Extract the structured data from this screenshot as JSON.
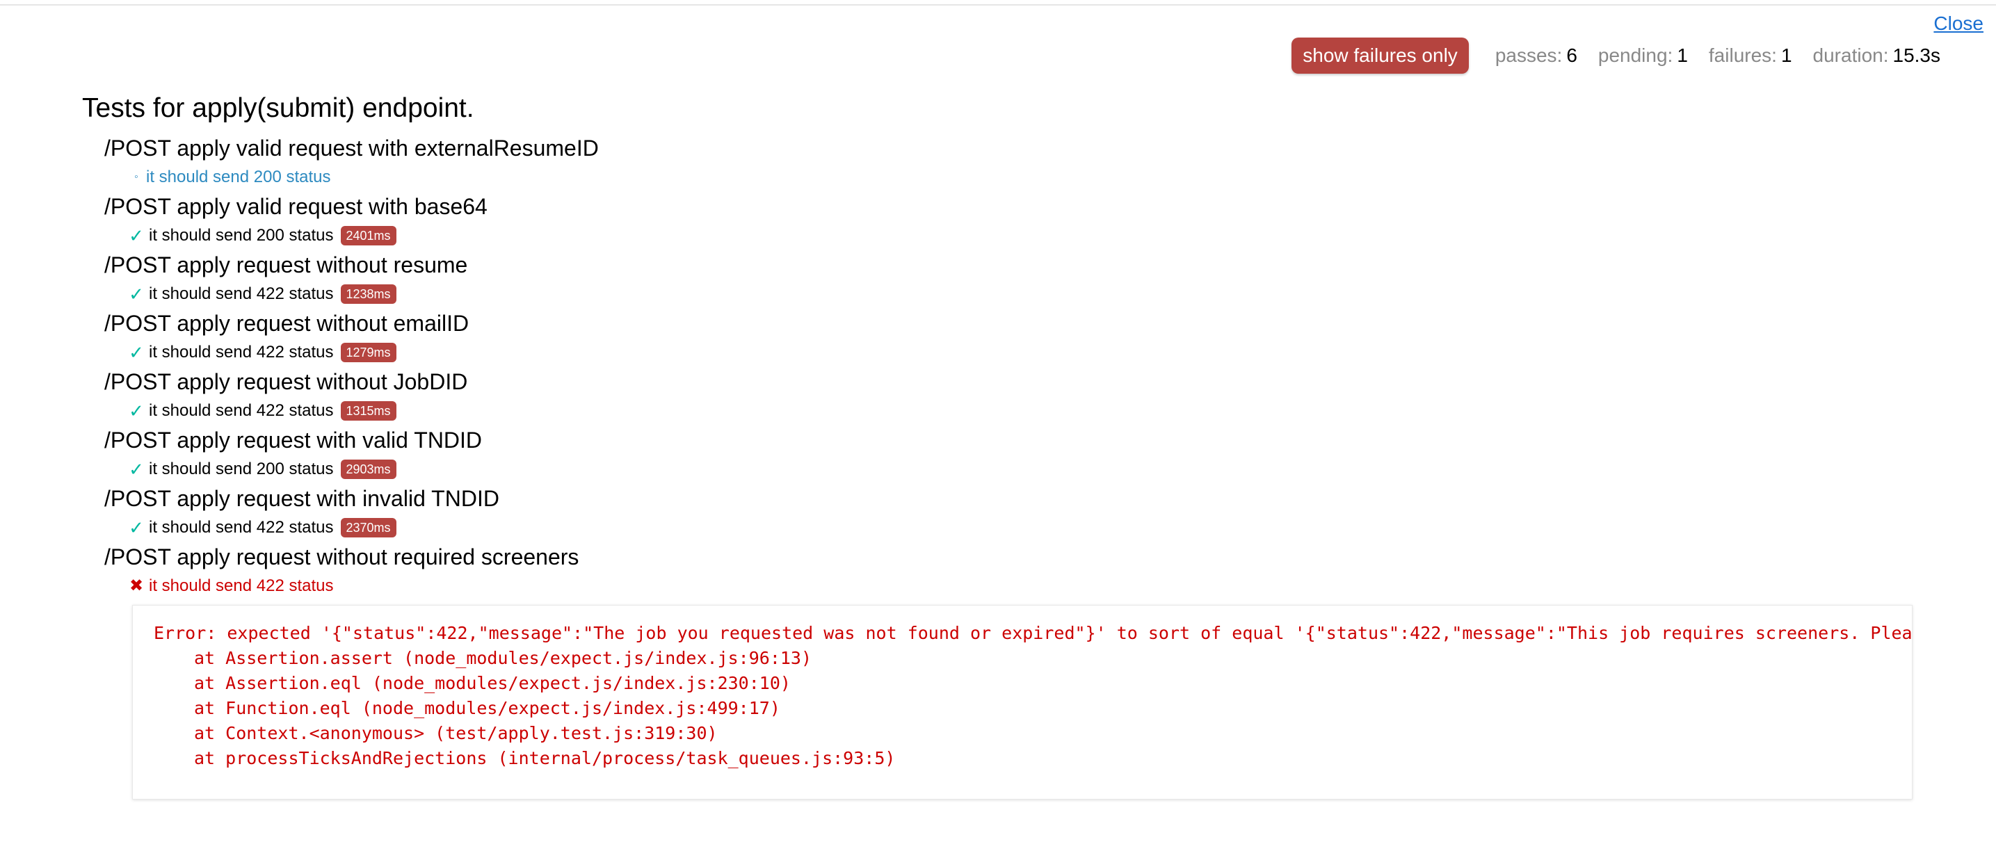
{
  "close_label": "Close",
  "stats": {
    "failures_button_label": "show failures only",
    "passes_label": "passes:",
    "passes_value": "6",
    "pending_label": "pending:",
    "pending_value": "1",
    "failures_label": "failures:",
    "failures_value": "1",
    "duration_label": "duration:",
    "duration_value": "15.3s"
  },
  "suite": {
    "title": "Tests for apply(submit) endpoint.",
    "subsuites": [
      {
        "title": "/POST apply valid request with externalResumeID",
        "test": {
          "status": "pending",
          "icon": "pending-icon",
          "title": "it should send 200 status",
          "duration": ""
        }
      },
      {
        "title": "/POST apply valid request with base64",
        "test": {
          "status": "pass",
          "icon": "checkmark-icon",
          "title": "it should send 200 status",
          "duration": "2401ms"
        }
      },
      {
        "title": "/POST apply request without resume",
        "test": {
          "status": "pass",
          "icon": "checkmark-icon",
          "title": "it should send 422 status",
          "duration": "1238ms"
        }
      },
      {
        "title": "/POST apply request without emailID",
        "test": {
          "status": "pass",
          "icon": "checkmark-icon",
          "title": "it should send 422 status",
          "duration": "1279ms"
        }
      },
      {
        "title": "/POST apply request without JobDID",
        "test": {
          "status": "pass",
          "icon": "checkmark-icon",
          "title": "it should send 422 status",
          "duration": "1315ms"
        }
      },
      {
        "title": "/POST apply request with valid TNDID",
        "test": {
          "status": "pass",
          "icon": "checkmark-icon",
          "title": "it should send 200 status",
          "duration": "2903ms"
        }
      },
      {
        "title": "/POST apply request with invalid TNDID",
        "test": {
          "status": "pass",
          "icon": "checkmark-icon",
          "title": "it should send 422 status",
          "duration": "2370ms"
        }
      },
      {
        "title": "/POST apply request without required screeners",
        "test": {
          "status": "fail",
          "icon": "cross-icon",
          "title": "it should send 422 status",
          "duration": ""
        }
      }
    ]
  },
  "error": {
    "message": "Error: expected '{\"status\":422,\"message\":\"The job you requested was not found or expired\"}' to sort of equal '{\"status\":422,\"message\":\"This job requires screeners. Please add s",
    "stack": [
      "at Assertion.assert (node_modules/expect.js/index.js:96:13)",
      "at Assertion.eql (node_modules/expect.js/index.js:230:10)",
      "at Function.eql (node_modules/expect.js/index.js:499:17)",
      "at Context.<anonymous> (test/apply.test.js:319:30)",
      "at processTicksAndRejections (internal/process/task_queues.js:93:5)"
    ]
  },
  "colors": {
    "accent": "#b5443f",
    "pass": "#00b8a0",
    "pending": "#2d8ac0",
    "fail": "#cc0000"
  }
}
